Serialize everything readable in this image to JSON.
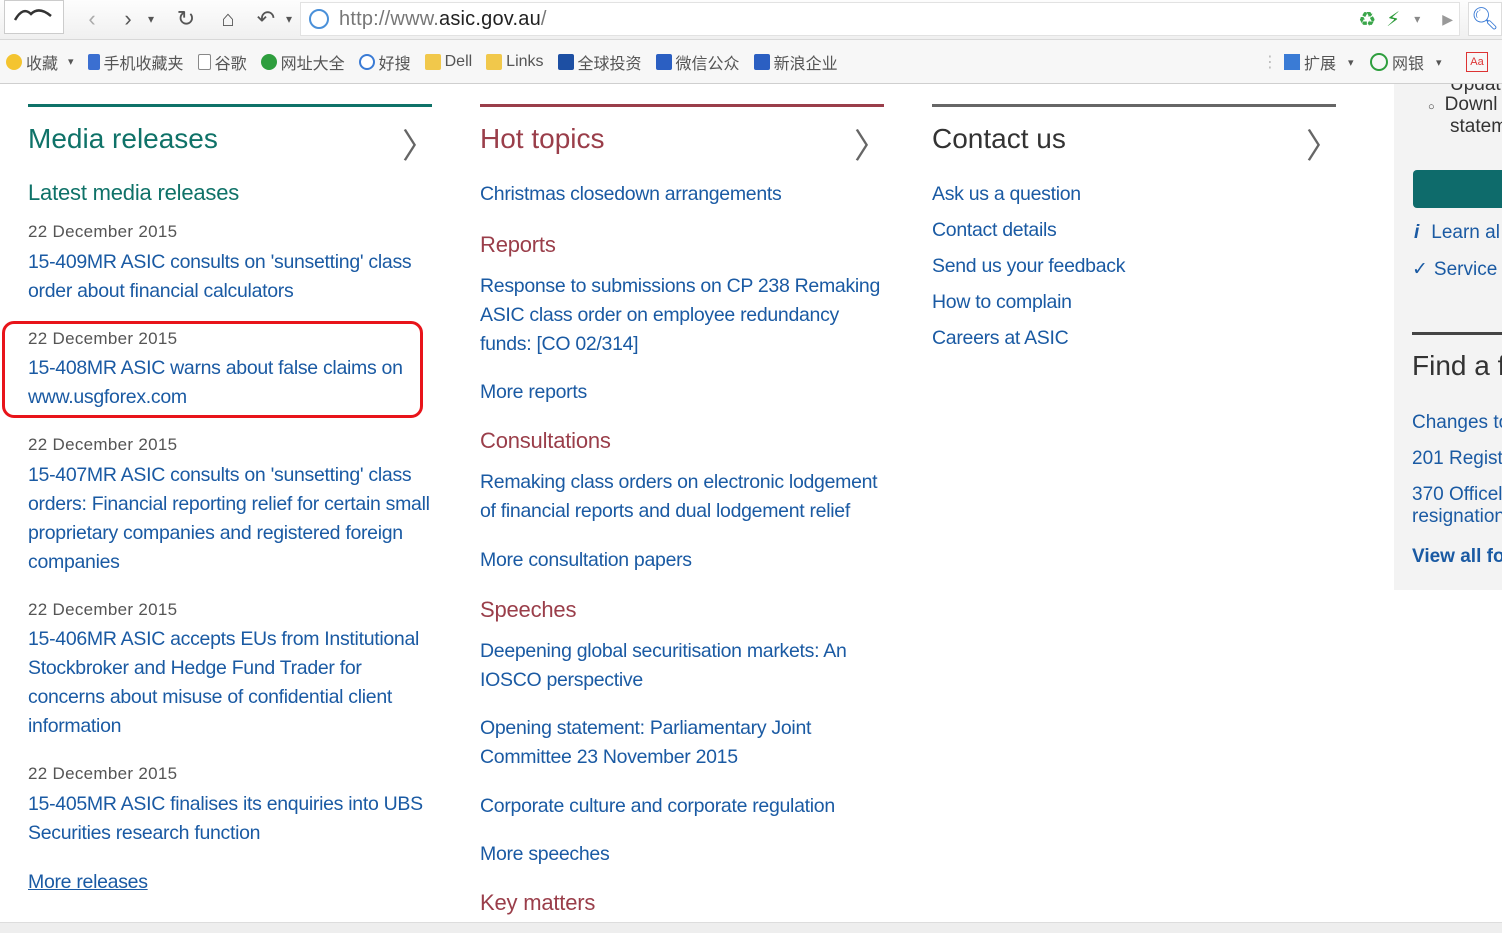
{
  "browser": {
    "url_scheme": "http://www.",
    "url_host": "asic.gov.au",
    "url_path": "/",
    "bookmarks": [
      "收藏",
      "手机收藏夹",
      "谷歌",
      "网址大全",
      "好搜",
      "Dell",
      "Links",
      "全球投资",
      "微信公众",
      "新浪企业"
    ],
    "extensions_label": "扩展",
    "netbank_label": "网银"
  },
  "media": {
    "title": "Media releases",
    "latest_label": "Latest media releases",
    "items": [
      {
        "date": "22 December 2015",
        "line1": "15-409MR ASIC consults on 'sunsetting' class",
        "line2": "order about financial calculators"
      },
      {
        "date": "22 December 2015",
        "line1": "15-408MR ASIC warns about false claims on",
        "line2": "www.usgforex.com"
      },
      {
        "date": "22 December 2015",
        "line1": "15-407MR ASIC consults on 'sunsetting' class",
        "line2": "orders: Financial reporting relief for certain small",
        "line3": "proprietary companies and registered foreign",
        "line4": "companies"
      },
      {
        "date": "22 December 2015",
        "line1": "15-406MR ASIC accepts EUs from Institutional",
        "line2": "Stockbroker and Hedge Fund Trader for",
        "line3": "concerns about misuse of confidential client",
        "line4": "information"
      },
      {
        "date": "22 December 2015",
        "line1": "15-405MR ASIC finalises its enquiries into UBS",
        "line2": "Securities research function"
      }
    ],
    "more_label": "More releases"
  },
  "hot": {
    "title": "Hot topics",
    "christmas": "Christmas closedown arrangements",
    "reports_heading": "Reports",
    "report_l1": "Response to submissions on CP 238 Remaking",
    "report_l2": "ASIC class order on employee redundancy",
    "report_l3": "funds: [CO 02/314]",
    "more_reports": "More reports",
    "consult_heading": "Consultations",
    "consult_l1": "Remaking class orders on electronic lodgement",
    "consult_l2": "of financial reports and dual lodgement relief",
    "more_consult": "More consultation papers",
    "speeches_heading": "Speeches",
    "speech1_l1": "Deepening global securitisation markets: An",
    "speech1_l2": "IOSCO perspective",
    "speech2_l1": "Opening statement: Parliamentary Joint",
    "speech2_l2": "Committee 23 November 2015",
    "speech3": "Corporate culture and corporate regulation",
    "more_speeches": "More speeches",
    "key_heading": "Key matters"
  },
  "contact": {
    "title": "Contact us",
    "links": [
      "Ask us a question",
      "Contact details",
      "Send us your feedback",
      "How to complain",
      "Careers at ASIC"
    ]
  },
  "right": {
    "top1": "Updat",
    "top2": "Downl",
    "top3": "statem",
    "learn": "Learn al",
    "service": "Service",
    "find_title": "Find a f",
    "f1": "Changes to",
    "f2": "201 Regist",
    "f3": "370 Officel",
    "f3b": "resignation",
    "view_all": "View all fo"
  },
  "colors": {
    "teal": "#0f7268",
    "maroon": "#9a3e4a",
    "link": "#1a5aa3",
    "highlight": "#e8141a"
  }
}
